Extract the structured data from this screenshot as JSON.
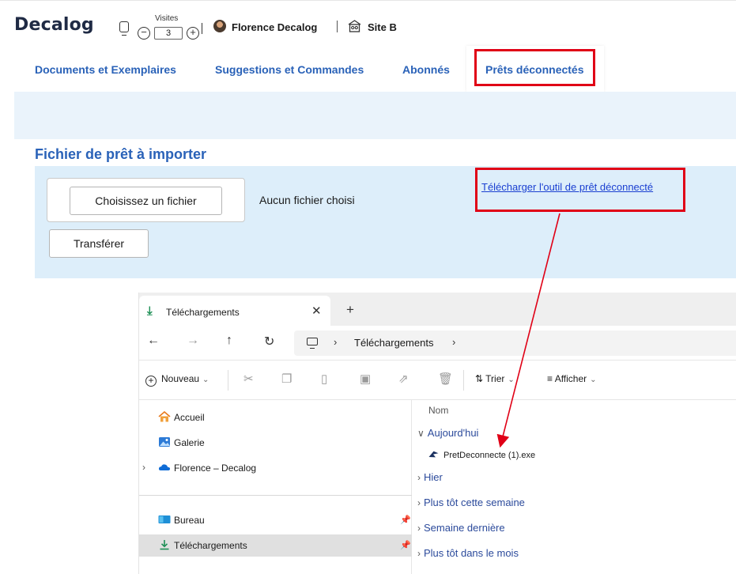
{
  "header": {
    "logo": "Decalog",
    "visites_label": "Visites",
    "visites_value": "3",
    "user_name": "Florence Decalog",
    "site_name": "Site B"
  },
  "tabs": [
    {
      "label": "Documents et Exemplaires",
      "active": false
    },
    {
      "label": "Suggestions et Commandes",
      "active": false
    },
    {
      "label": "Abonnés",
      "active": false
    },
    {
      "label": "Prêts déconnectés",
      "active": true
    }
  ],
  "form": {
    "section_title": "Fichier de prêt à importer",
    "choose_file_label": "Choisissez un fichier",
    "no_file_text": "Aucun fichier choisi",
    "transfer_label": "Transférer",
    "download_link": "Télécharger l'outil de prêt déconnecté"
  },
  "explorer": {
    "tab_title": "Téléchargements",
    "address": "Téléchargements",
    "toolbar": {
      "new_label": "Nouveau",
      "sort_label": "Trier",
      "view_label": "Afficher"
    },
    "nav_items": [
      {
        "label": "Accueil",
        "icon": "home-icon"
      },
      {
        "label": "Galerie",
        "icon": "gallery-icon"
      },
      {
        "label": "Florence – Decalog",
        "icon": "cloud-icon"
      },
      {
        "label": "Bureau",
        "icon": "desktop-icon"
      },
      {
        "label": "Téléchargements",
        "icon": "download-icon"
      }
    ],
    "column_header": "Nom",
    "groups": [
      {
        "label": "Aujourd'hui",
        "expanded": true
      },
      {
        "label": "Hier",
        "expanded": false
      },
      {
        "label": "Plus tôt cette semaine",
        "expanded": false
      },
      {
        "label": "Semaine dernière",
        "expanded": false
      },
      {
        "label": "Plus tôt dans le mois",
        "expanded": false
      }
    ],
    "file_name": "PretDeconnecte (1).exe"
  },
  "colors": {
    "accent_blue": "#2a62b8",
    "highlight_red": "#e00016",
    "panel_blue": "#ddeefa",
    "link_blue": "#1a3fd1"
  }
}
